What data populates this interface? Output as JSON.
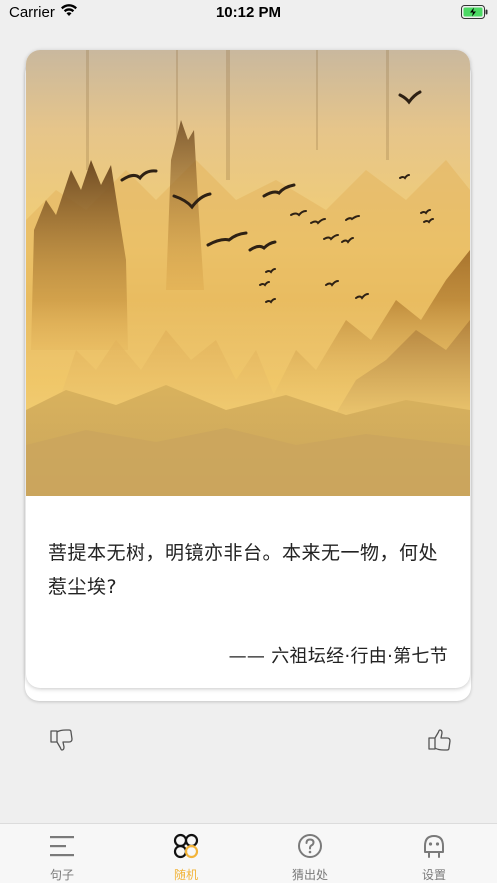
{
  "status_bar": {
    "carrier": "Carrier",
    "time": "10:12 PM"
  },
  "card": {
    "image_icon": "misty-mountains-birds-painting",
    "quote": "菩提本无树，明镜亦非台。本来无一物，何处惹尘埃?",
    "source": "—— 六祖坛经·行由·第七节"
  },
  "reactions": {
    "dislike_icon": "thumb-down-icon",
    "like_icon": "thumb-up-icon"
  },
  "tab_bar": {
    "active_color": "#f2b43a",
    "inactive_color": "#7a7a7a",
    "tabs": [
      {
        "label": "句子",
        "icon": "list-icon"
      },
      {
        "label": "随机",
        "icon": "shuffle-clover-icon"
      },
      {
        "label": "猜出处",
        "icon": "question-icon"
      },
      {
        "label": "设置",
        "icon": "robot-face-icon"
      }
    ]
  }
}
